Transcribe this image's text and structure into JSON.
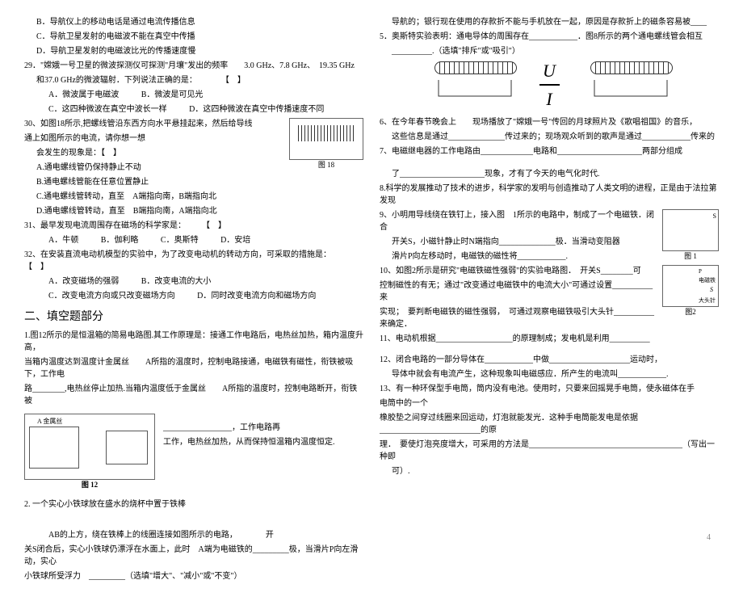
{
  "left": {
    "q28b": "B．导航仪上的移动电话是通过电流传播信息",
    "q28c": "C．导航卫星发射的电磁波不能在真空中传播",
    "q28d": "D．导航卫星发射的电磁波比光的传播速度慢",
    "q29": "29．\"嫦娥一号卫星的微波探测仪可探测\"月壤\"发出的频率　　3.0 GHz、7.8 GHz、　19.35 GHz",
    "q29line2": "和37.0 GHz的微波辐射．下列说法正确的是：　　　　【　】",
    "q29a": "A．微波属于电磁波",
    "q29b": "B．微波是可见光",
    "q29c": "C．这四种微波在真空中波长一样",
    "q29d": "D．这四种微波在真空中传播速度不同",
    "q30": "30、如图18所示,把螺线管沿东西方向水平悬挂起来，然后给导线",
    "q30line2": "通上如图所示的电流，请你想一想",
    "q30line3": "会发生的现象是：【　】",
    "q30a": "A.通电螺线管仍保持静止不动",
    "q30b": "B.通电螺线管能在任意位置静止",
    "q30c": "C.通电螺线管转动，直至　A端指向南，B端指向北",
    "q30d": "D.通电螺线管转动，直至　B端指向南，A端指向北",
    "q31": "31、最早发现电流周围存在磁场的科学家是：　　　【　】",
    "q31a": "A．牛顿",
    "q31b": "B．伽利略",
    "q31c": "C．奥斯特",
    "q31d": "D．安培",
    "q32": "32、在安装直流电动机模型的实验中，为了改变电动机的转动方向，可采取的措施是：　　　　　　　【　】",
    "q32a": "A．改变磁场的强弱",
    "q32b": "B．改变电流的大小",
    "q32c": "C．改变电流方向或只改变磁场方向",
    "q32d": "D．同时改变电流方向和磁场方向",
    "sectionTitle": "二、填空题部分",
    "fill1": "1.图12所示的是恒温箱的简易电路图.其工作原理是：接通工作电路后，电热丝加热，箱内温度升高，",
    "fill1b": "当箱内温度达到温度计金属丝　　A所指的温度时，控制电路接通，电磁铁有磁性，衔铁被吸下，工作电",
    "fill1c": "路________,电热丝停止加热.当箱内温度低于金属丝　　A所指的温度时，控制电路断开，衔铁被",
    "fill1d": "_________________，工作电路再",
    "fill1e": "工作，电热丝加热，从而保持恒温箱内温度恒定.",
    "fill2": "2. 一个实心小铁球放在盛水的烧杯中置于铁棒",
    "fill2b": "AB的上方，绕在铁棒上的线圈连接如图所示的电路，　　　　开",
    "fill2c": "关S闭合后，实心小铁球仍漂浮在水面上，此时　A端为电磁铁的_________极，当滑片P向左滑动，实心",
    "fill2d": "小铁球所受浮力　_________（选填\"增大\"、\"减小\"或\"不变\"）"
  },
  "right": {
    "r1": "导航的；银行现在使用的存款折不能与手机放在一起，原因是存款折上的磁条容易被____",
    "r2": "5．奥斯特实验表明：通电导体的周围存在____________．图8所示的两个通电螺线管会相互",
    "r2b": "__________.（选填\"排斥\"或\"吸引\"）",
    "r3": "6、在今年春节晚会上　　现场播放了\"嫦娥一号\"传回的月球照片及《歌唱祖国》的音乐，",
    "r3b": "这些信息是通过______________传过来的；现场观众听到的歌声是通过____________传来的",
    "r4": "7、电磁继电器的工作电路由_____________电路和_____________________两部分组成",
    "r5": "了_____________________现象，才有了今天的电气化时代.",
    "r5b": "8.科学的发展推动了技术的进步，科学家的发明与创造推动了人类文明的进程，正是由于法拉第发现",
    "r6": "9、小明用导线绕在铁钉上，接入图　1所示的电路中，制成了一个电磁铁．闭合",
    "r6b": "开关S，小磁针静止时N端指向______________极．当滑动变阻器",
    "r6c": "滑片P向左移动时，电磁铁的磁性将____________.",
    "r7": "10、如图2所示是研究\"电磁铁磁性强弱\"的实验电路图．　开关S________可",
    "r7b": "控制磁性的有无；通过\"改变通过电磁铁中的电流大小\"可通过设置__________来",
    "r7c": "实现；　要判断电磁铁的磁性强弱，　可通过观察电磁铁吸引大头针__________来确定．",
    "r8": "11、电动机根据___________________的原理制成；发电机是利用__________",
    "r9": "12、闭合电路的一部分导体在____________中做____________________运动时，",
    "r9b": "导体中就会有电流产生，这种现象叫电磁感应．所产生的电流叫____________.",
    "r10": "13、有一种环保型手电筒，筒内没有电池。使用时，只要来回摇晃手电筒，使永磁体在手",
    "r10b": "电筒中的一个",
    "r10c": "橡胶垫之间穿过线圈来回运动，灯泡就能发光．这种手电筒能发电是依据_________________________的原",
    "r10d": "理．　要使灯泡亮度增大，可采用的方法是______________________________________（写出一种即",
    "r10e": "可）.",
    "fig1label": "图 1",
    "fig2label": "图2"
  },
  "pageNum": "4"
}
